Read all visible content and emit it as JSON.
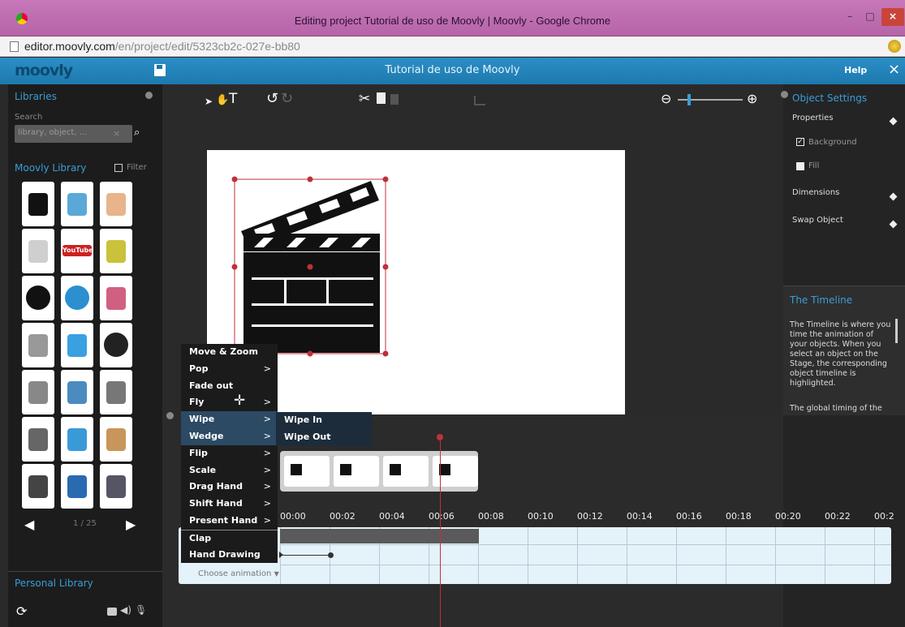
{
  "window": {
    "title": "Editing project Tutorial de uso de Moovly | Moovly - Google Chrome",
    "minimize": "–",
    "maximize": "□",
    "close": "×"
  },
  "address": {
    "domain": "editor.moovly.com",
    "path": "/en/project/edit/5323cb2c-027e-bb80"
  },
  "app": {
    "logo": "moovly",
    "project_title": "Tutorial de uso de Moovly",
    "help": "Help",
    "close": "×"
  },
  "libraries": {
    "heading": "Libraries",
    "search_label": "Search",
    "search_placeholder": "library, object, ...",
    "moovly_library": "Moovly Library",
    "filter": "Filter",
    "page": "1 / 25",
    "personal_library": "Personal Library"
  },
  "thumbs": [
    "clapperboard",
    "world-map",
    "hand-finger",
    "world-map-light",
    "youtube",
    "man-standing",
    "globe",
    "apple",
    "woman-standing",
    "woman-sketch",
    "blue-plant",
    "soccer-ball",
    "man-cart",
    "car",
    "magnifier",
    "stick-figure",
    "bicycle",
    "thumbs-up",
    "cassette",
    "bottle",
    "books"
  ],
  "thumb_text": {
    "youtube": "YouTube"
  },
  "object_settings": {
    "heading": "Object Settings",
    "properties": "Properties",
    "background": "Background",
    "fill": "Fill",
    "dimensions": "Dimensions",
    "swap_object": "Swap Object"
  },
  "timeline_help": {
    "heading": "The Timeline",
    "body": "The Timeline is where you time the animation of your objects. When you select an object on the Stage, the corresponding object timeline is highlighted.",
    "more": "The global timing of the"
  },
  "animation_menu": [
    {
      "label": "Move & Zoom",
      "sub": false
    },
    {
      "label": "Pop",
      "sub": true
    },
    {
      "label": "Fade out",
      "sub": false
    },
    {
      "label": "Fly",
      "sub": true
    },
    {
      "label": "Wipe",
      "sub": true
    },
    {
      "label": "Wedge",
      "sub": true
    },
    {
      "label": "Flip",
      "sub": true
    },
    {
      "label": "Scale",
      "sub": true
    },
    {
      "label": "Drag Hand",
      "sub": true
    },
    {
      "label": "Shift Hand",
      "sub": true
    },
    {
      "label": "Present Hand",
      "sub": true
    },
    {
      "label": "Clap",
      "sub": false
    },
    {
      "label": "Hand Drawing",
      "sub": false
    }
  ],
  "submenu": [
    "Wipe In",
    "Wipe Out"
  ],
  "submenu_arrow": ">",
  "choose_animation": "Choose animation",
  "time_ticks": [
    "00:00",
    "00:02",
    "00:04",
    "00:06",
    "00:08",
    "00:10",
    "00:12",
    "00:14",
    "00:16",
    "00:18",
    "00:20",
    "00:22",
    "00:2"
  ]
}
